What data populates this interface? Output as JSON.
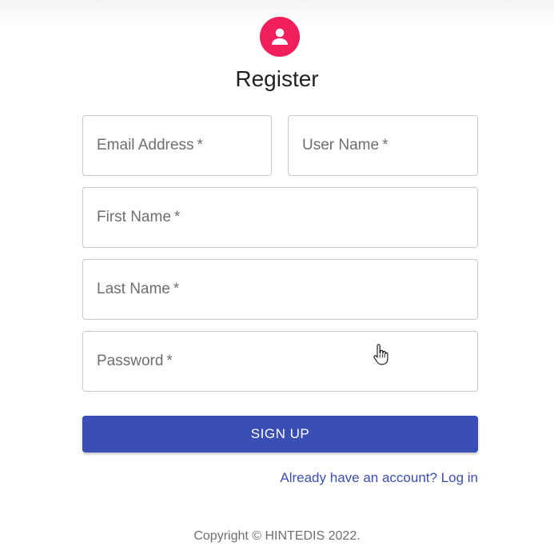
{
  "header": {
    "avatar_icon": "person-icon",
    "avatar_color": "#f01f5c",
    "title": "Register"
  },
  "form": {
    "email": {
      "label": "Email Address",
      "required_mark": "*"
    },
    "username": {
      "label": "User Name",
      "required_mark": "*"
    },
    "first_name": {
      "label": "First Name",
      "required_mark": "*"
    },
    "last_name": {
      "label": "Last Name",
      "required_mark": "*"
    },
    "password": {
      "label": "Password",
      "required_mark": "*"
    },
    "submit_label": "SIGN UP",
    "submit_color": "#3a4fb5",
    "login_link": "Already have an account? Log in"
  },
  "footer": {
    "copyright": "Copyright © HINTEDIS 2022."
  },
  "cursor": {
    "type": "hand-pointer-icon"
  }
}
